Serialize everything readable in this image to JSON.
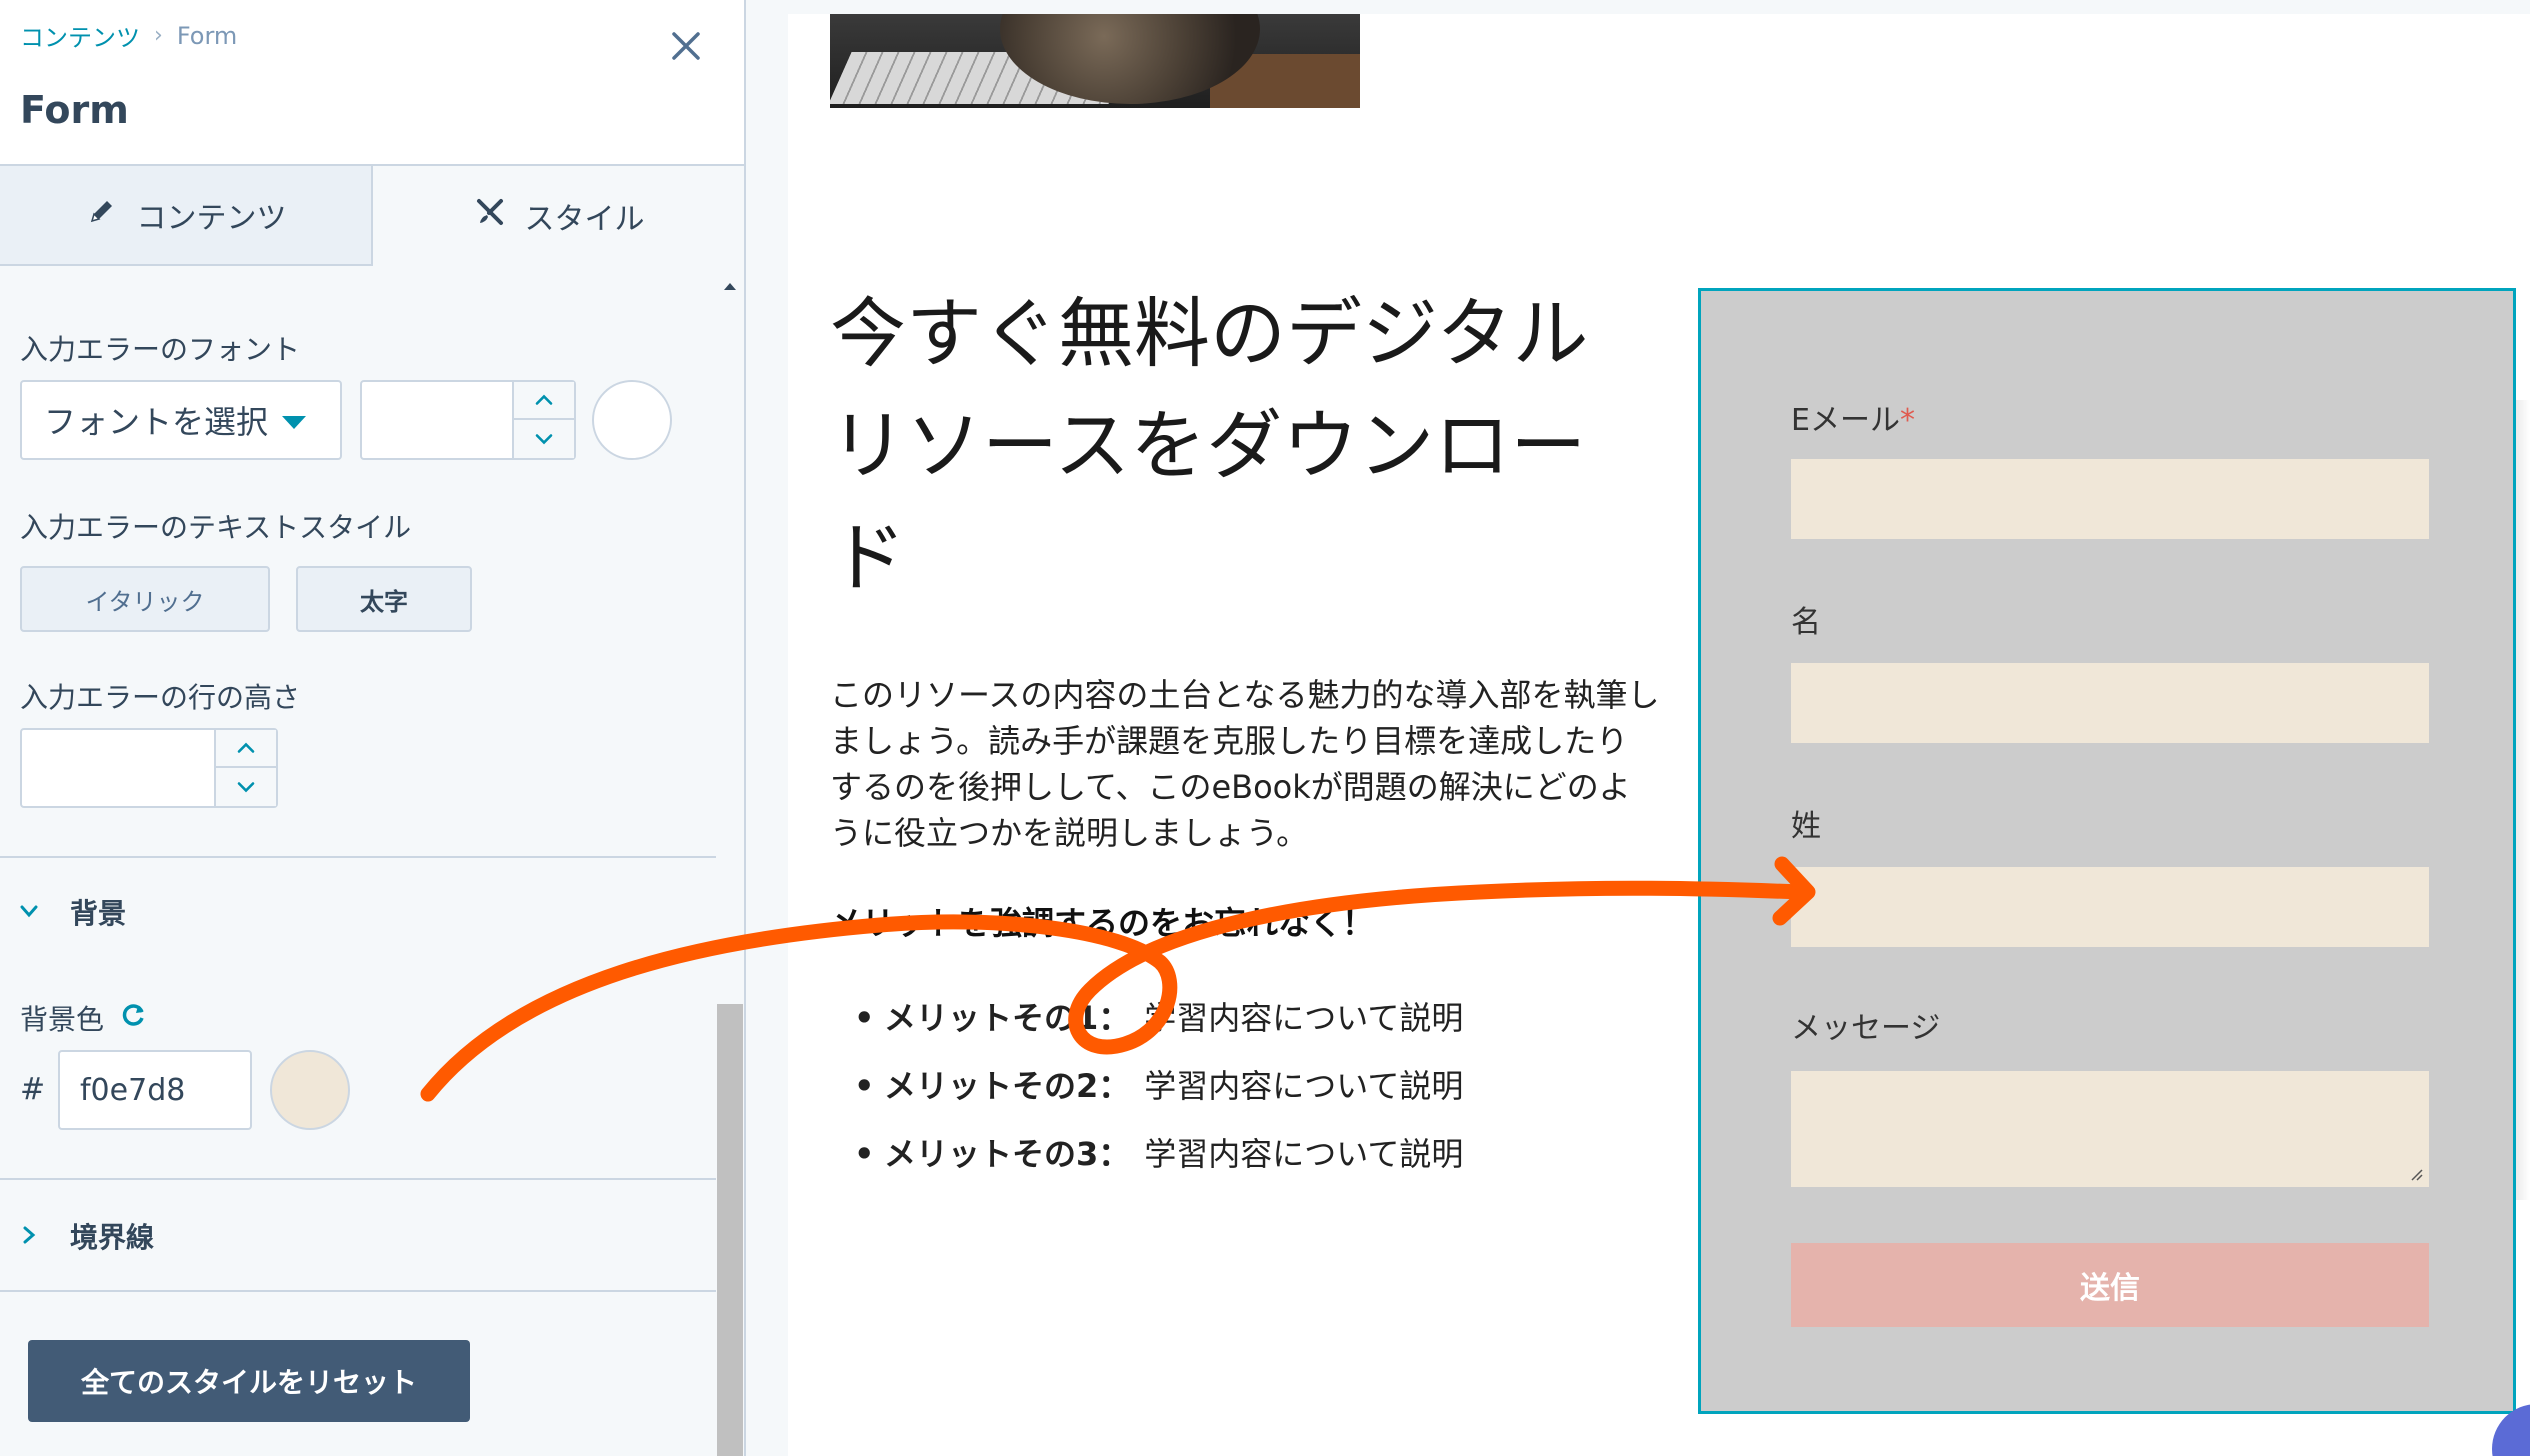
{
  "panel": {
    "breadcrumb_link": "コンテンツ",
    "breadcrumb_separator": "›",
    "breadcrumb_current": "Form",
    "title": "Form",
    "tabs": [
      {
        "label": "コンテンツ",
        "icon": "pencil-icon"
      },
      {
        "label": "スタイル",
        "icon": "brush-ruler-icon"
      }
    ],
    "error_font": {
      "label": "入力エラーのフォント",
      "select_value": "フォントを選択",
      "size_value": "",
      "color": "#ffffff"
    },
    "error_text_style": {
      "label": "入力エラーのテキストスタイル",
      "italic_label": "イタリック",
      "bold_label": "太字"
    },
    "error_line_height": {
      "label": "入力エラーの行の高さ",
      "value": ""
    },
    "background_section": {
      "title": "背景",
      "expanded": true,
      "bg_color_label": "背景色",
      "hex_prefix": "#",
      "hex_value": "f0e7d8",
      "swatch_color": "#f0e7d8"
    },
    "border_section": {
      "title": "境界線",
      "expanded": false
    },
    "reset_button": "全てのスタイルをリセット"
  },
  "preview": {
    "headline": "今すぐ無料のデジタルリソースをダウンロード",
    "body": "このリソースの内容の土台となる魅力的な導入部を執筆しましょう。読み手が課題を克服したり目標を達成したりするのを後押しして、このeBookが問題の解決にどのように役立つかを説明しましょう。",
    "emphasis": "メリットを強調するのをお忘れなく！",
    "benefits": [
      {
        "title": "メリットその1：",
        "text": "学習内容について説明"
      },
      {
        "title": "メリットその2：",
        "text": "学習内容について説明"
      },
      {
        "title": "メリットその3：",
        "text": "学習内容について説明"
      }
    ],
    "form": {
      "background": "#cccccc",
      "field_background": "#f0e7d8",
      "fields": [
        {
          "label": "Eメール",
          "required": "*"
        },
        {
          "label": "名",
          "required": ""
        },
        {
          "label": "姓",
          "required": ""
        },
        {
          "label": "メッセージ",
          "required": ""
        }
      ],
      "submit_label": "送信",
      "submit_color": "#e5b3ac"
    }
  },
  "colors": {
    "accent": "#0091ae",
    "annotation_arrow": "#ff5a00",
    "form_border": "#00a4bd"
  }
}
